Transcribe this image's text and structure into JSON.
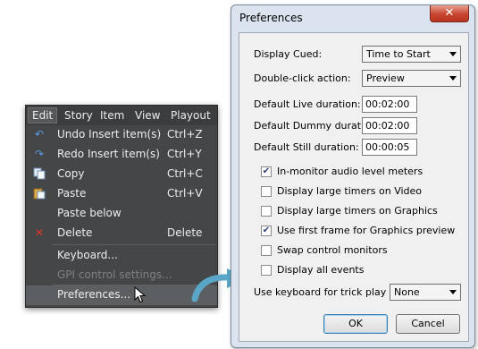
{
  "menu": {
    "bar": [
      "Edit",
      "Story",
      "Item",
      "View",
      "Playout"
    ],
    "items": [
      {
        "label": "Undo Insert item(s)",
        "shortcut": "Ctrl+Z",
        "icon": "undo-icon"
      },
      {
        "label": "Redo Insert item(s)",
        "shortcut": "Ctrl+Y",
        "icon": "redo-icon"
      },
      {
        "label": "Copy",
        "shortcut": "Ctrl+C",
        "icon": "copy-icon"
      },
      {
        "label": "Paste",
        "shortcut": "Ctrl+V",
        "icon": "paste-icon"
      },
      {
        "label": "Paste below",
        "shortcut": "",
        "icon": ""
      },
      {
        "label": "Delete",
        "shortcut": "Delete",
        "icon": "delete-icon"
      },
      {
        "label": "Keyboard...",
        "shortcut": "",
        "icon": ""
      },
      {
        "label": "GPI control settings...",
        "shortcut": "",
        "icon": "",
        "disabled": true
      },
      {
        "label": "Preferences...",
        "shortcut": "",
        "icon": "",
        "highlighted": true
      }
    ]
  },
  "dialog": {
    "title": "Preferences",
    "close_glyph": "✕",
    "display_cued": {
      "label": "Display Cued:",
      "value": "Time to Start"
    },
    "double_click": {
      "label": "Double-click action:",
      "value": "Preview"
    },
    "live_duration": {
      "label": "Default Live duration:",
      "value": "00:02:00"
    },
    "dummy_duration": {
      "label": "Default Dummy duration:",
      "value": "00:02:00"
    },
    "still_duration": {
      "label": "Default Still duration:",
      "value": "00:00:05"
    },
    "checkboxes": [
      {
        "label": "In-monitor audio level meters",
        "checked": true
      },
      {
        "label": "Display large timers on Video",
        "checked": false
      },
      {
        "label": "Display large timers on Graphics",
        "checked": false
      },
      {
        "label": "Use first frame for Graphics preview",
        "checked": true
      },
      {
        "label": "Swap control monitors",
        "checked": false
      },
      {
        "label": "Display all events",
        "checked": false
      }
    ],
    "trick_play": {
      "label": "Use keyboard for trick play on:",
      "value": "None"
    },
    "ok_label": "OK",
    "cancel_label": "Cancel"
  },
  "colors": {
    "menu_bg": "#444648",
    "dialog_frame": "#dbe4ee",
    "arrow": "#5aa6c8"
  }
}
